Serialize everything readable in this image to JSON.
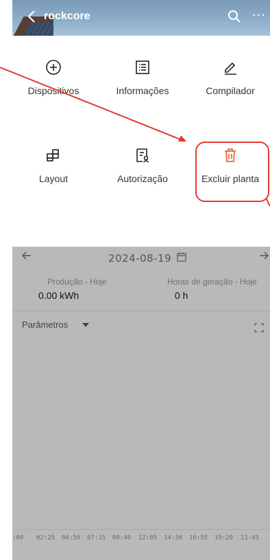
{
  "header": {
    "title": "rockcore",
    "back_icon": "chevron-left-icon",
    "search_icon": "search-icon",
    "more_label": "···"
  },
  "menu": {
    "items": [
      {
        "label": "Dispositivos",
        "icon": "plus-circle-icon"
      },
      {
        "label": "Informações",
        "icon": "list-icon"
      },
      {
        "label": "Compilador",
        "icon": "pencil-icon"
      },
      {
        "label": "Layout",
        "icon": "grid-layout-icon"
      },
      {
        "label": "Autorização",
        "icon": "authorization-icon"
      },
      {
        "label": "Excluir planta",
        "icon": "trash-icon",
        "color": "#e8643c"
      }
    ]
  },
  "date_bar": {
    "date": "2024-08-19",
    "prev_icon": "arrow-left-icon",
    "next_icon": "arrow-right-icon",
    "calendar_icon": "calendar-icon"
  },
  "stats": {
    "production_label": "Produção - Hoje",
    "production_value": "0.00 kWh",
    "hours_label": "Horas de geração - Hoje",
    "hours_value": "0 h"
  },
  "chart": {
    "params_label": "Parâmetros",
    "x_ticks": [
      ":00",
      "02:25",
      "04:50",
      "07:15",
      "09:40",
      "12:05",
      "14:30",
      "16:55",
      "19:20",
      "21:45"
    ]
  },
  "colors": {
    "overlay": "#b9b9b9",
    "accent": "#e53935",
    "trash": "#e8643c"
  }
}
